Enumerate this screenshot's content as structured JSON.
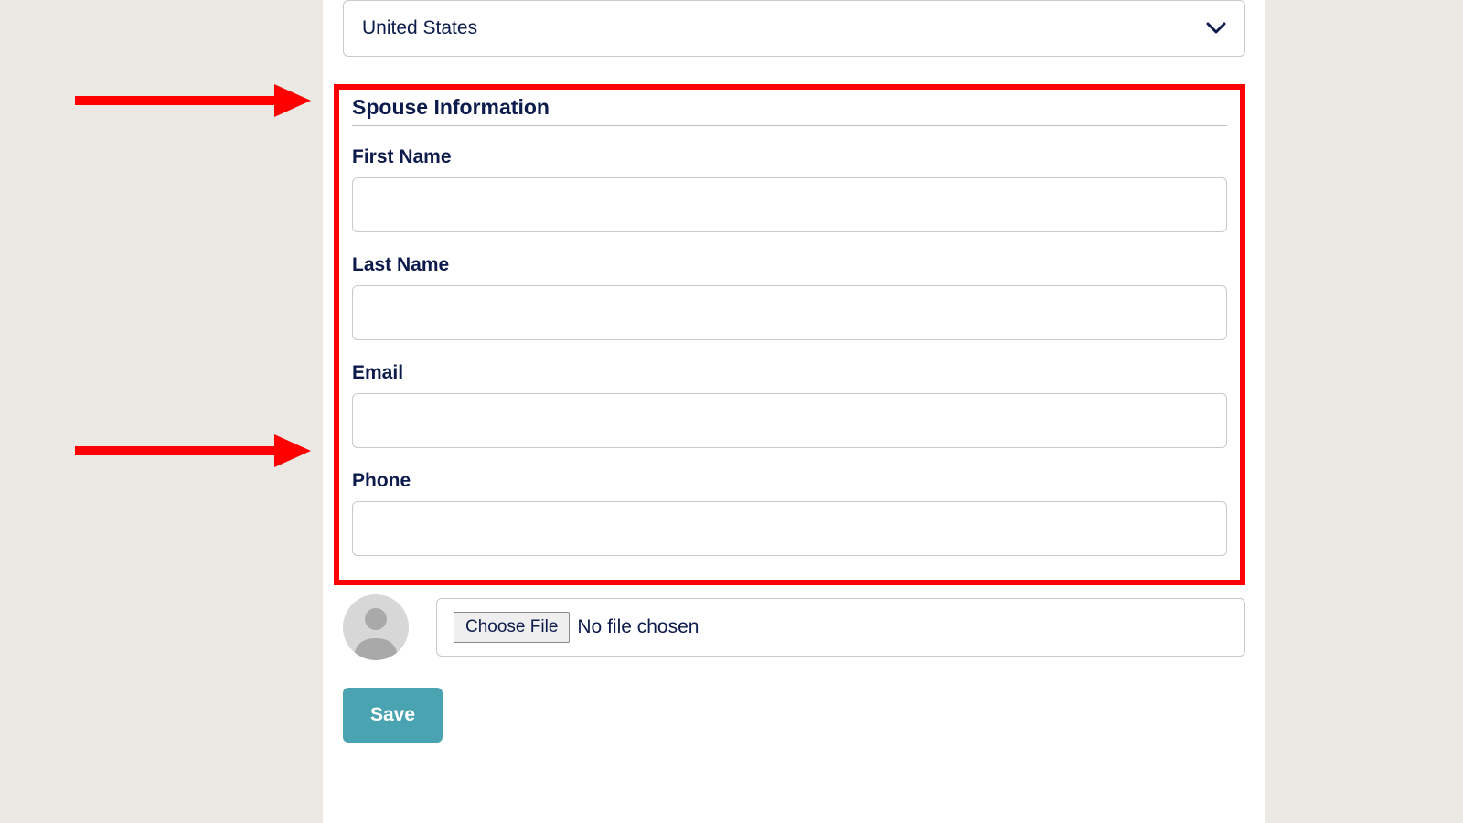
{
  "country": {
    "selected": "United States"
  },
  "spouse_section": {
    "title": "Spouse Information",
    "fields": {
      "first_name": {
        "label": "First Name",
        "value": ""
      },
      "last_name": {
        "label": "Last Name",
        "value": ""
      },
      "email": {
        "label": "Email",
        "value": ""
      },
      "phone": {
        "label": "Phone",
        "value": ""
      }
    }
  },
  "file_upload": {
    "button_label": "Choose File",
    "status": "No file chosen"
  },
  "actions": {
    "save_label": "Save"
  }
}
